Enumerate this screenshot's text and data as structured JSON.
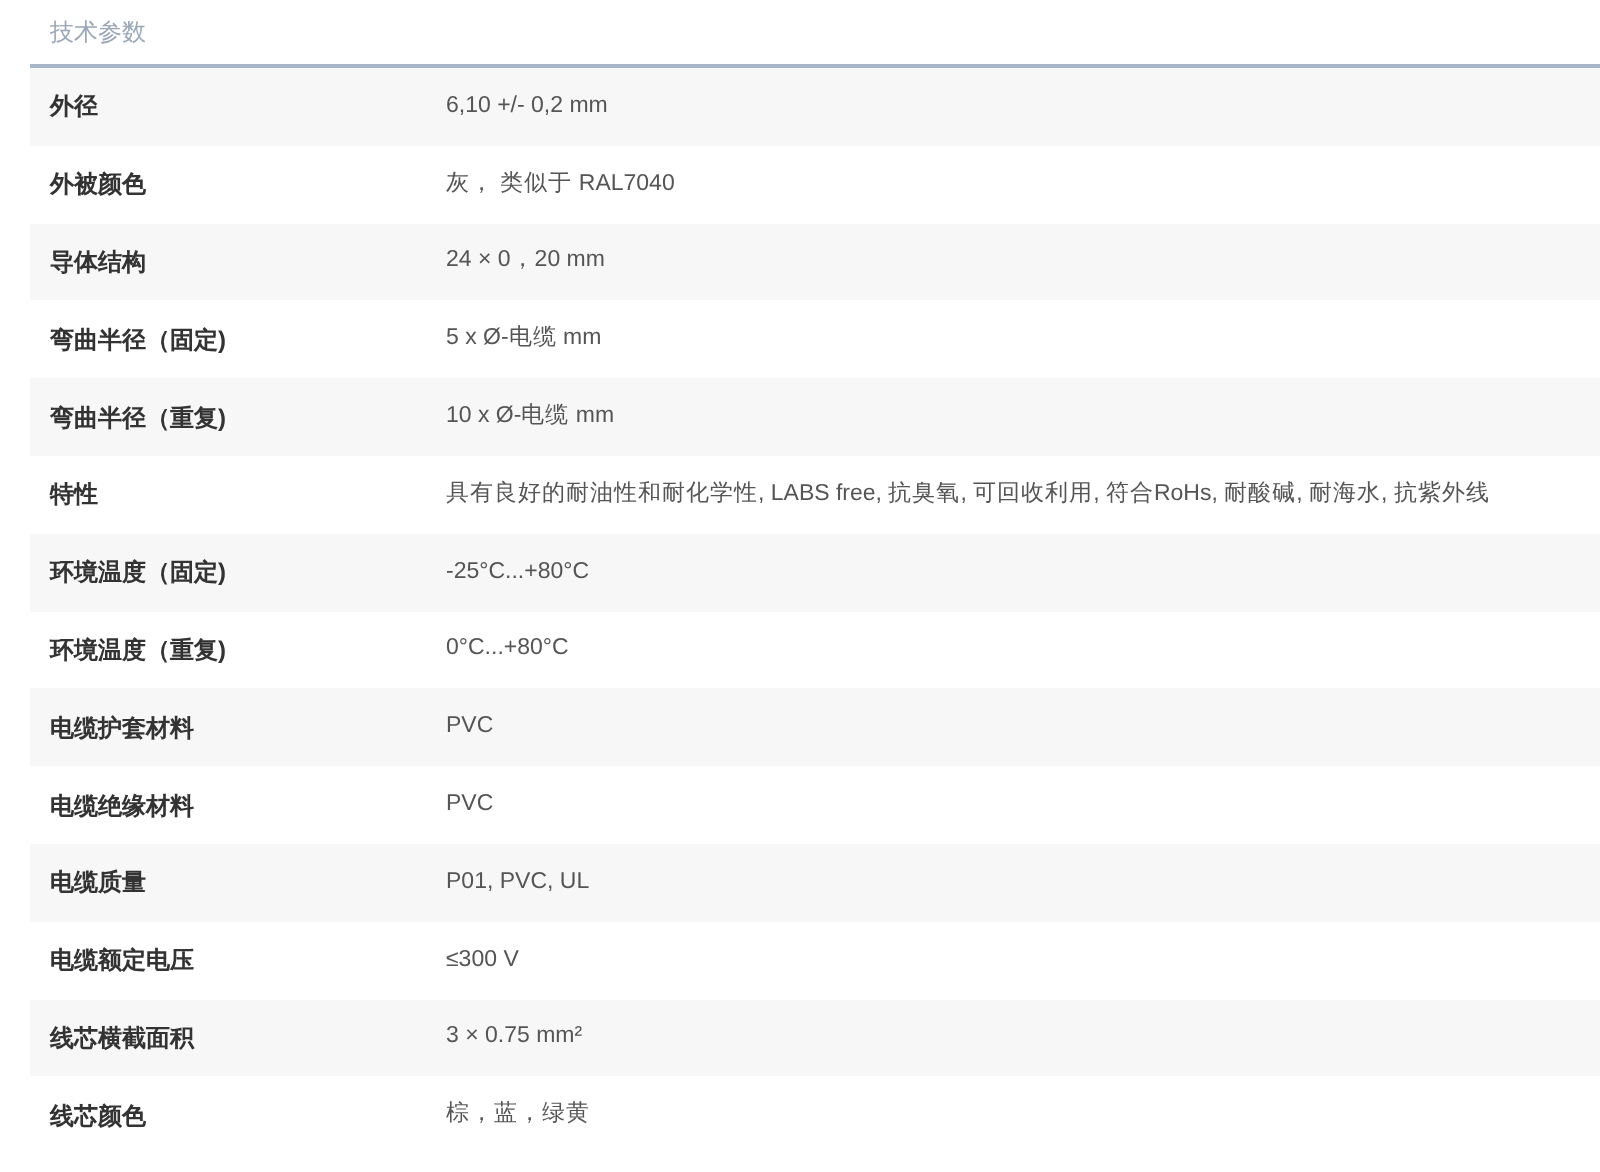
{
  "section_title": "技术参数",
  "rows": [
    {
      "label": "外径",
      "value": "6,10 +/- 0,2 mm"
    },
    {
      "label": "外被颜色",
      "value": "灰， 类似于 RAL7040"
    },
    {
      "label": "导体结构",
      "value": "24 × 0，20 mm"
    },
    {
      "label": "弯曲半径（固定)",
      "value": "5 x Ø-电缆 mm"
    },
    {
      "label": "弯曲半径（重复)",
      "value": "10 x Ø-电缆 mm"
    },
    {
      "label": "特性",
      "value": "具有良好的耐油性和耐化学性, LABS free, 抗臭氧, 可回收利用, 符合RoHs, 耐酸碱, 耐海水, 抗紫外线"
    },
    {
      "label": "环境温度（固定)",
      "value": "-25°C...+80°C"
    },
    {
      "label": "环境温度（重复)",
      "value": "0°C...+80°C"
    },
    {
      "label": "电缆护套材料",
      "value": "PVC"
    },
    {
      "label": "电缆绝缘材料",
      "value": "PVC"
    },
    {
      "label": "电缆质量",
      "value": "P01, PVC, UL"
    },
    {
      "label": "电缆额定电压",
      "value": "≤300 V"
    },
    {
      "label": "线芯横截面积",
      "value": "3 × 0.75 mm²"
    },
    {
      "label": "线芯颜色",
      "value": "棕，蓝，绿黄"
    }
  ]
}
